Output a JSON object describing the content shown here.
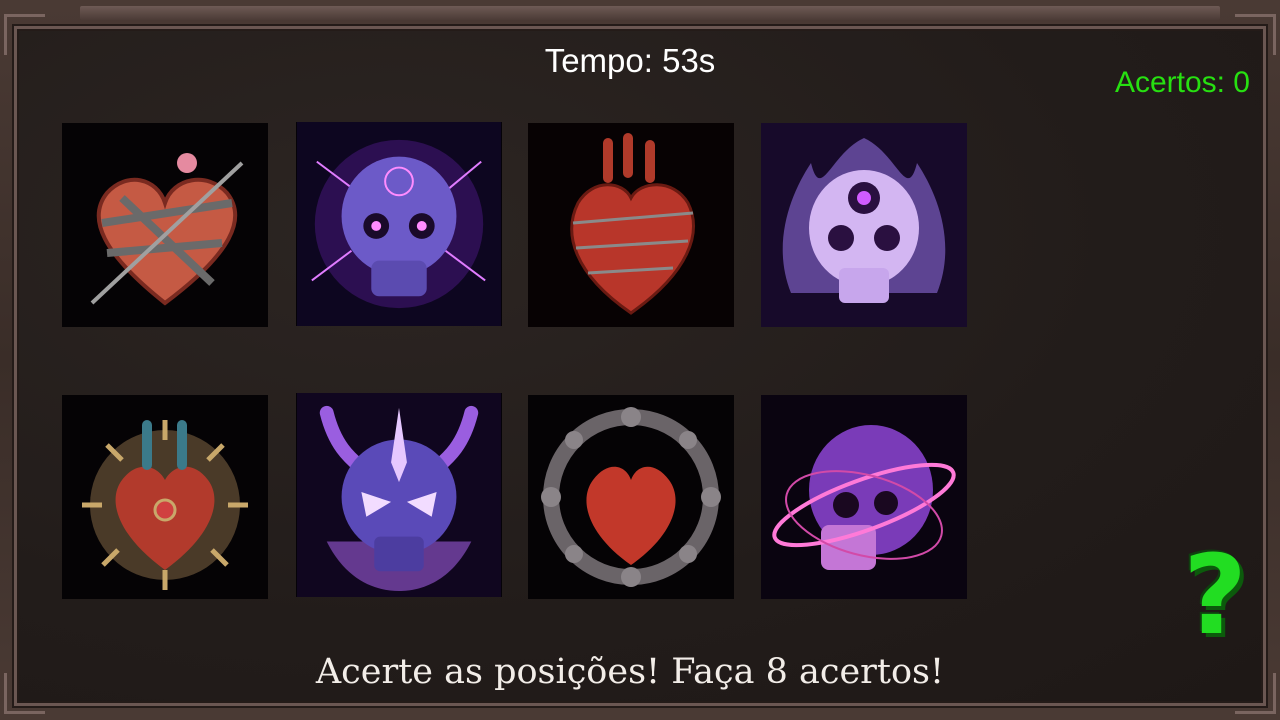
{
  "hud": {
    "timer": "Tempo: 53s",
    "score": "Acertos: 0"
  },
  "instruction": "Acerte as posições! Faça 8 acertos!",
  "help_button": "?",
  "cards": [
    {
      "icon": "heart-wrapped-bandage-icon",
      "theme": "heart"
    },
    {
      "icon": "purple-skull-lightning-icon",
      "theme": "skull"
    },
    {
      "icon": "anatomical-heart-barbed-wire-icon",
      "theme": "heart"
    },
    {
      "icon": "flaming-skull-target-icon",
      "theme": "skull"
    },
    {
      "icon": "mechanical-spiked-heart-icon",
      "theme": "heart"
    },
    {
      "icon": "horned-demon-skull-icon",
      "theme": "skull"
    },
    {
      "icon": "heart-in-rune-ring-icon",
      "theme": "heart"
    },
    {
      "icon": "pink-orbit-skull-icon",
      "theme": "skull"
    }
  ],
  "colors": {
    "score": "#27e011",
    "help": "#22dd22",
    "heart": "#c2412f",
    "skull": "#9a6ee0"
  }
}
